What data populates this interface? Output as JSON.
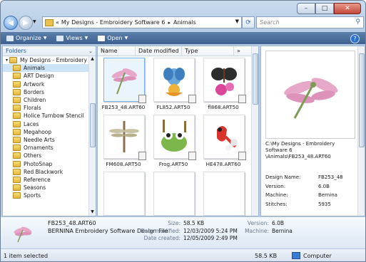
{
  "window": {
    "minimize": "–",
    "maximize": "□",
    "close": "✕"
  },
  "address": {
    "path_prefix": "«",
    "crumb1": "My Designs - Embroidery Software 6",
    "separator": "▸",
    "crumb2": "Animals",
    "search_placeholder": "Search"
  },
  "toolbar": {
    "organize": "Organize",
    "views": "Views",
    "open": "Open"
  },
  "folders": {
    "header": "Folders",
    "root": "My Designs - Embroidery",
    "items": [
      "Animals",
      "ART Design",
      "Artwork",
      "Borders",
      "Children",
      "Florals",
      "Holice Turnbow Stencil",
      "Laces",
      "Megahoop",
      "Needle Arts",
      "Ornaments",
      "Others",
      "PhotoSnap",
      "Red Blackwork",
      "Reference",
      "Seasons",
      "Sports"
    ],
    "selected": "Animals"
  },
  "columns": {
    "name": "Name",
    "date_modified": "Date modified",
    "type": "Type",
    "more": "»"
  },
  "files": [
    {
      "name": "FB253_48.ART60",
      "selected": true
    },
    {
      "name": "FL852.ART50",
      "selected": false
    },
    {
      "name": "fl868.ART50",
      "selected": false
    },
    {
      "name": "FM608.ART50",
      "selected": false
    },
    {
      "name": "Frog.ART50",
      "selected": false
    },
    {
      "name": "HE478.ART60",
      "selected": false
    }
  ],
  "preview": {
    "path": "C:\\My Designs - Embroidery Software 6 \\Animals\\FB253_48.ART60",
    "props": [
      {
        "k": "Design Name:",
        "v": "FB253_48"
      },
      {
        "k": "Version:",
        "v": "6.0B"
      },
      {
        "k": "Machine:",
        "v": "Bernina"
      },
      {
        "k": "Stitches:",
        "v": "5935"
      }
    ]
  },
  "details": {
    "name": "FB253_48.ART60",
    "type": "BERNINA Embroidery Software Design File",
    "size_label": "Size:",
    "size": "58.5 KB",
    "modified_label": "Date modified:",
    "modified": "12/03/2009 5:24 PM",
    "created_label": "Date created:",
    "created": "12/05/2009 2:49 PM",
    "version_label": "Version:",
    "version": "6.0B",
    "machine_label": "Machine:",
    "machine": "Bernina"
  },
  "status": {
    "selection": "1 item selected",
    "size": "58.5 KB",
    "location": "Computer"
  },
  "colors": {
    "accent": "#3e6190",
    "selection": "#cde4f7"
  }
}
